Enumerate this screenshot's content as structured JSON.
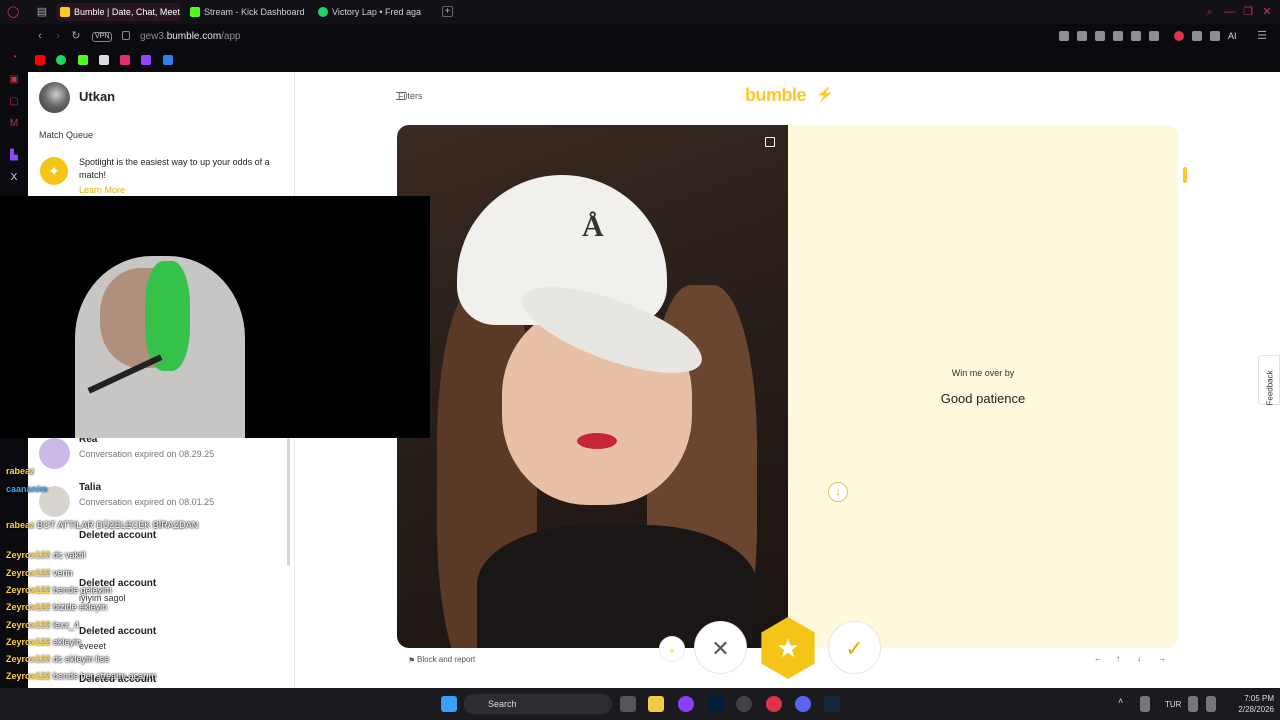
{
  "browser": {
    "tabs": [
      {
        "label": "Bumble | Date, Chat, Meet"
      },
      {
        "label": "Stream - Kick Dashboard"
      },
      {
        "label": "Victory Lap • Fred aga"
      }
    ],
    "url_prefix": "gew3.",
    "url_domain": "bumble.com",
    "url_path": "/app",
    "vpn_label": "VPN",
    "ai_label": "AI"
  },
  "sidebar_left": {
    "user_name": "Utkan",
    "match_queue_label": "Match Queue",
    "spotlight_text": "Spotlight is the easiest way to up your odds of a match!",
    "learn_more": "Learn More",
    "conversations": [
      {
        "name": "Rea",
        "status": "Conversation expired on 08.29.25"
      },
      {
        "name": "Talia",
        "status": "Conversation expired on 08.01.25"
      },
      {
        "name": "Deleted account",
        "status": ""
      },
      {
        "name": "Deleted account",
        "status": ""
      },
      {
        "name": "Deleted account",
        "status": ""
      },
      {
        "name": "Deleted account",
        "status": ""
      }
    ]
  },
  "main": {
    "filters_label": "Filters",
    "brand": "bumble",
    "prompt_label": "Win me over by",
    "prompt_answer": "Good patience",
    "block_report": "Block and report",
    "feedback": "Feedback",
    "actions": {
      "rewind": "«",
      "pass": "✕",
      "superswipe": "★",
      "like": "✓"
    },
    "keys": [
      "←",
      "↑",
      "↓",
      "→"
    ]
  },
  "stream_chat": [
    {
      "user": "rabeaz",
      "msg": "",
      "color": "#ffd23a"
    },
    {
      "user": "caananim",
      "msg": "",
      "color": "#3aa6ff"
    },
    {
      "user": "rabeaz",
      "msg": "BOT ATTILAR DÜZELECEK BİRAZDAN",
      "color": "#ffd23a"
    },
    {
      "user": "Zeyrox122",
      "msg": "dc vaktil",
      "color": "#ffd23a"
    },
    {
      "user": "Zeyrox122",
      "msg": "verin",
      "color": "#ffd23a"
    },
    {
      "user": "Zeyrox122",
      "msg": "bende geleyim",
      "color": "#ffd23a"
    },
    {
      "user": "Zeyrox122",
      "msg": "bizide ekleyin",
      "color": "#ffd23a"
    },
    {
      "user": "Zeyrox122",
      "msg": "lexx_4",
      "color": "#ffd23a"
    },
    {
      "user": "Zeyrox122",
      "msg": "ekleyin",
      "color": "#ffd23a"
    },
    {
      "user": "Zeyrox122",
      "msg": "dc ekleyin lise",
      "color": "#ffd23a"
    },
    {
      "user": "Zeyrox122",
      "msg": "bende her streamı acarım",
      "color": "#ffd23a"
    },
    {
      "user": "Zeyrox122",
      "msg": "dc eklemesseniz",
      "color": "#ffd23a"
    },
    {
      "user": "Zeyrox122",
      "msg": "küserim",
      "color": "#ffd23a"
    }
  ],
  "chat_fragments": {
    "iyiyim": "iyiyim sagol",
    "eveeet": "eveeet"
  },
  "taskbar": {
    "search_label": "Search",
    "lang": "TUR",
    "time": "7:05 PM",
    "date": "2/28/2026"
  }
}
